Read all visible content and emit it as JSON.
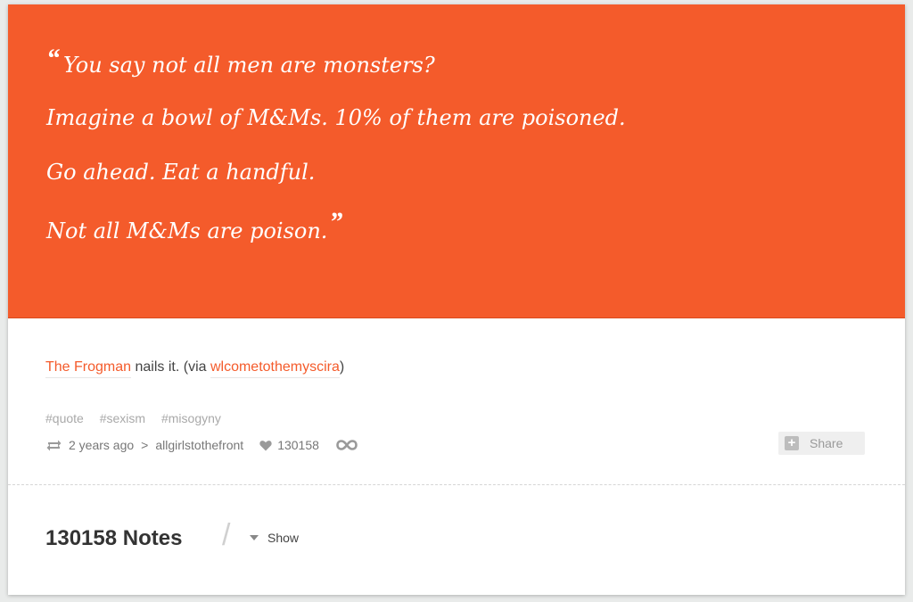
{
  "quote": {
    "open_mark": "“",
    "close_mark": "”",
    "lines": [
      "You say not all men are monsters?",
      "Imagine a bowl of M&Ms. 10% of them are poisoned.",
      "Go ahead. Eat a handful.",
      "Not all M&Ms are poison."
    ],
    "background_color": "#f45b2b"
  },
  "caption": {
    "author": "The Frogman",
    "text_middle": " nails it. (via ",
    "source": "wlcometothemyscira",
    "text_end": ")"
  },
  "tags": [
    "#quote",
    "#sexism",
    "#misogyny"
  ],
  "meta": {
    "reblog_icon": "reblog-icon",
    "time_ago": "2 years ago",
    "separator": ">",
    "reblogged_from": "allgirlstothefront",
    "heart_icon": "heart-icon",
    "like_count": "130158",
    "permalink_icon": "infinity-link-icon"
  },
  "share": {
    "icon": "plus-icon",
    "label": "Share"
  },
  "notes": {
    "count_label": "130158 Notes",
    "slash": "/",
    "toggle_label": "Show"
  }
}
